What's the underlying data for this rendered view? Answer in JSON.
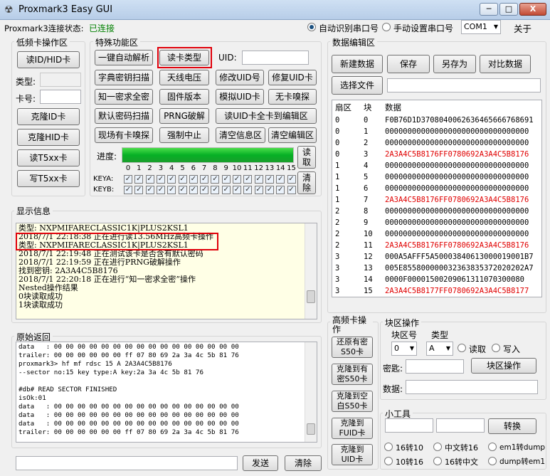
{
  "window": {
    "title": "Proxmark3 Easy GUI",
    "min": "─",
    "max": "□",
    "close": "X"
  },
  "topbar": {
    "status_label": "Proxmark3连接状态:",
    "status_value": "已连接",
    "auto_port": "自动识别串口号",
    "manual_port": "手动设置串口号",
    "port_value": "COM1",
    "about": "关于"
  },
  "lf": {
    "title": "低频卡操作区",
    "read_btn": "读ID/HID卡",
    "type_label": "类型:",
    "cardno_label": "卡号:",
    "clone_id": "克隆ID卡",
    "clone_hid": "克隆HID卡",
    "read_t5": "读T5xx卡",
    "write_t5": "写T5xx卡"
  },
  "special": {
    "title": "特殊功能区",
    "buttons": [
      "一键自动解析",
      "读卡类型",
      "字典密钥扫描",
      "天线电压",
      "修改UID号",
      "修复UID卡",
      "知一密求全密",
      "固件版本",
      "模拟UID卡",
      "无卡嗅探",
      "默认密码扫描",
      "PRNG破解",
      "读UID卡全卡到编辑区",
      "现场有卡嗅探",
      "强制中止",
      "清空信息区",
      "清空编辑区"
    ],
    "uid_label": "UID:",
    "progress_label": "进度:",
    "progress": 1.0,
    "read_btn": "读\n取",
    "clear_btn": "清\n除",
    "sectors": [
      "0",
      "1",
      "2",
      "3",
      "4",
      "5",
      "6",
      "7",
      "8",
      "9",
      "10",
      "11",
      "12",
      "13",
      "14",
      "15"
    ],
    "keya": "KEYA:",
    "keyb": "KEYB:",
    "check": "✓"
  },
  "display": {
    "title": "显示信息",
    "lines": [
      "类型: NXPMIFARECLASSIC1K|PLUS2KSL1",
      "2018/7/1 22:18:38 正在进行读13.56MHz高频卡操作",
      "类型: NXPMIFARECLASSIC1K|PLUS2KSL1",
      "2018/7/1 22:19:48 正在测试该卡是否含有默认密码",
      "2018/7/1 22:19:59 正在进行PRNG破解操作",
      "找到密钥: 2A3A4C5B8176",
      "2018/7/1 22:20:18 正在进行“知一密求全密”操作",
      "Nested操作结果",
      "0块读取成功",
      "1块读取成功"
    ]
  },
  "raw": {
    "title": "原始返回",
    "lines": [
      "data   : 00 00 00 00 00 00 00 00 00 00 00 00 00 00 00 00",
      "trailer: 00 00 00 00 00 00 ff 07 80 69 2a 3a 4c 5b 81 76",
      "proxmark3> hf mf rdsc 15 A 2A3A4C5B8176",
      "--sector no:15 key type:A key:2a 3a 4c 5b 81 76",
      "",
      "#db# READ SECTOR FINISHED",
      "isOk:01",
      "data   : 00 00 00 00 00 00 00 00 00 00 00 00 00 00 00 00",
      "data   : 00 00 00 00 00 00 00 00 00 00 00 00 00 00 00 00",
      "data   : 00 00 00 00 00 00 00 00 00 00 00 00 00 00 00 00",
      "trailer: 00 00 00 00 00 00 ff 07 80 69 2a 3a 4c 5b 81 76"
    ],
    "send": "发送",
    "clear": "清除"
  },
  "editor": {
    "title": "数据编辑区",
    "new": "新建数据",
    "save": "保存",
    "saveas": "另存为",
    "compare": "对比数据",
    "choose": "选择文件",
    "headers": [
      "扇区",
      "块",
      "数据"
    ],
    "rows": [
      [
        "0",
        "0",
        "F0B76D1D3708040062636465666768691",
        "n"
      ],
      [
        "0",
        "1",
        "00000000000000000000000000000000",
        "n"
      ],
      [
        "0",
        "2",
        "00000000000000000000000000000000",
        "n"
      ],
      [
        "0",
        "3",
        "2A3A4C5B8176FF0780692A3A4C5B8176",
        "r"
      ],
      [
        "1",
        "4",
        "00000000000000000000000000000000",
        "n"
      ],
      [
        "1",
        "5",
        "00000000000000000000000000000000",
        "n"
      ],
      [
        "1",
        "6",
        "00000000000000000000000000000000",
        "n"
      ],
      [
        "1",
        "7",
        "2A3A4C5B8176FF0780692A3A4C5B8176",
        "r"
      ],
      [
        "2",
        "8",
        "00000000000000000000000000000000",
        "n"
      ],
      [
        "2",
        "9",
        "00000000000000000000000000000000",
        "n"
      ],
      [
        "2",
        "10",
        "00000000000000000000000000000000",
        "n"
      ],
      [
        "2",
        "11",
        "2A3A4C5B8176FF0780692A3A4C5B8176",
        "r"
      ],
      [
        "3",
        "12",
        "000A5AFFF5A50003840613000019001B7",
        "n"
      ],
      [
        "3",
        "13",
        "005E855800000032363835372020202A7",
        "n"
      ],
      [
        "3",
        "14",
        "0000F00001500209061311070300080",
        "n"
      ],
      [
        "3",
        "15",
        "2A3A4C5B8177FF0780692A3A4C5B8177",
        "r"
      ]
    ]
  },
  "hf": {
    "title": "高频卡操\n作",
    "restore": "还原有密\nS50卡",
    "clone_key": "克隆到有\n密S50卡",
    "clone_blank": "克隆到空\n白S50卡",
    "clone_fuid": "克隆到\nFUID卡",
    "clone_uid": "克隆到\nUID卡"
  },
  "block": {
    "title": "块区操作",
    "block_label": "块区号",
    "type_label": "类型",
    "block_value": "0",
    "type_value": "A",
    "read": "读取",
    "write": "写入",
    "key_label": "密匙:",
    "op": "块区操作",
    "data_label": "数据:"
  },
  "tools": {
    "title": "小工具",
    "convert": "转换",
    "opts": [
      "16转10",
      "中文转16",
      "em1转dump",
      "10转16",
      "16转中文",
      "dump转em1"
    ]
  }
}
